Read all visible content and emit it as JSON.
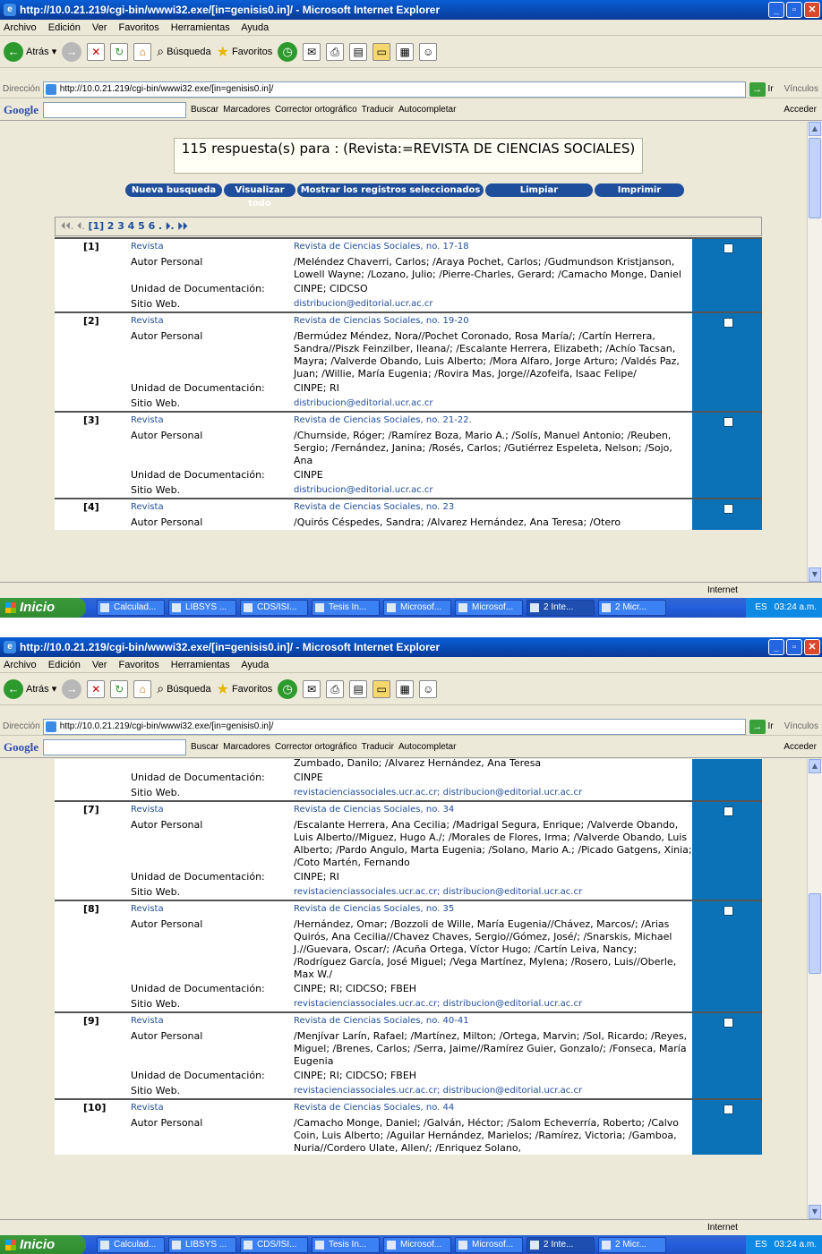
{
  "window": {
    "title": "http://10.0.21.219/cgi-bin/wwwi32.exe/[in=genisis0.in]/ - Microsoft Internet Explorer",
    "buttons": [
      "_",
      "▫",
      "✕"
    ]
  },
  "menu": [
    "Archivo",
    "Edición",
    "Ver",
    "Favoritos",
    "Herramientas",
    "Ayuda"
  ],
  "toolbar": {
    "back": "Atrás",
    "search": "Búsqueda",
    "favorites": "Favoritos"
  },
  "address": {
    "label": "Dirección",
    "url": "http://10.0.21.219/cgi-bin/wwwi32.exe/[in=genisis0.in]/",
    "go": "Ir",
    "links": "Vínculos"
  },
  "google": {
    "logo": "Google",
    "buscar": "Buscar",
    "marcadores": "Marcadores",
    "corrector": "Corrector ortográfico",
    "traducir": "Traducir",
    "autocompletar": "Autocompletar",
    "acceder": "Acceder"
  },
  "status": {
    "zone": "Internet"
  },
  "taskbar": {
    "start": "Inicio",
    "tasks": [
      "Calculad...",
      "LIBSYS ...",
      "CDS/ISI...",
      "Tesis In...",
      "Microsof...",
      "Microsof...",
      "2 Inte...",
      "2 Micr..."
    ],
    "lang": "ES",
    "time": "03:24 a.m."
  },
  "page": {
    "heading": "115 respuesta(s) para : (Revista:=REVISTA DE CIENCIAS SOCIALES)",
    "buttons": [
      "Nueva busqueda",
      "Visualizar todo",
      "Mostrar los registros seleccionados",
      "Limpiar",
      "Imprimir"
    ],
    "nav": {
      "prev": "⏴⏴. ⏴.",
      "current": "[1]",
      "pages": "2 3 4 5 6",
      "next": ". ⏵. ⏵⏵"
    }
  },
  "labels": {
    "revista": "Revista",
    "autor": "Autor Personal",
    "unidad": "Unidad de Documentación:",
    "sitio": "Sitio Web."
  },
  "records_top": [
    {
      "num": "[1]",
      "revista": "Revista de Ciencias Sociales, no. 17-18",
      "autor": "/Meléndez Chaverri, Carlos; /Araya Pochet, Carlos; /Gudmundson Kristjanson, Lowell Wayne; /Lozano, Julio; /Pierre-Charles, Gerard; /Camacho Monge, Daniel",
      "unidad": "CINPE; CIDCSO",
      "sitio": "distribucion@editorial.ucr.ac.cr"
    },
    {
      "num": "[2]",
      "revista": "Revista de Ciencias Sociales, no. 19-20",
      "autor": "/Bermúdez Méndez, Nora//Pochet Coronado, Rosa María/; /Cartín Herrera, Sandra//Piszk Feinzilber, Ileana/; /Escalante Herrera, Elizabeth; /Achío Tacsan, Mayra; /Valverde Obando, Luis Alberto; /Mora Alfaro, Jorge Arturo; /Valdés Paz, Juan; /Willie, María Eugenia; /Rovira Mas, Jorge//Azofeifa, Isaac Felipe/",
      "unidad": "CINPE; RI",
      "sitio": "distribucion@editorial.ucr.ac.cr"
    },
    {
      "num": "[3]",
      "revista": "Revista de Ciencias Sociales, no. 21-22.",
      "autor": "/Churnside, Róger; /Ramírez Boza, Mario A.; /Solís, Manuel Antonio; /Reuben, Sergio; /Fernández, Janina; /Rosés, Carlos; /Gutiérrez Espeleta, Nelson; /Sojo, Ana",
      "unidad": "CINPE",
      "sitio": "distribucion@editorial.ucr.ac.cr"
    },
    {
      "num": "[4]",
      "revista": "Revista de Ciencias Sociales, no. 23",
      "autor": "/Quirós Céspedes, Sandra; /Alvarez Hernández, Ana Teresa; /Otero"
    }
  ],
  "records_bottom": [
    {
      "num": "",
      "autor_tail": "Zumbado, Danilo; /Alvarez Hernández, Ana Teresa",
      "unidad": "CINPE",
      "sitio": "revistacienciassociales.ucr.ac.cr; distribucion@editorial.ucr.ac.cr"
    },
    {
      "num": "[7]",
      "revista": "Revista de Ciencias Sociales, no. 34",
      "autor": "/Escalante Herrera, Ana Cecilia; /Madrigal Segura, Enrique; /Valverde Obando, Luis Alberto//Miguez, Hugo A./; /Morales de Flores, Irma; /Valverde Obando, Luis Alberto; /Pardo Angulo, Marta Eugenia; /Solano, Mario A.; /Picado Gatgens, Xinia; /Coto Martén, Fernando",
      "unidad": "CINPE; RI",
      "sitio": "revistacienciassociales.ucr.ac.cr; distribucion@editorial.ucr.ac.cr"
    },
    {
      "num": "[8]",
      "revista": "Revista de Ciencias Sociales, no. 35",
      "autor": "/Hernández, Omar; /Bozzoli de Wille, María Eugenia//Chávez, Marcos/; /Arias Quirós, Ana Cecilia//Chavez Chaves, Sergio//Gómez, José/; /Snarskis, Michael J.//Guevara, Oscar/; /Acuña Ortega, Víctor Hugo; /Cartín Leiva, Nancy; /Rodríguez García, José Miguel; /Vega Martínez, Mylena; /Rosero, Luis//Oberle, Max W./",
      "unidad": "CINPE; RI; CIDCSO; FBEH",
      "sitio": "revistacienciassociales.ucr.ac.cr; distribucion@editorial.ucr.ac.cr"
    },
    {
      "num": "[9]",
      "revista": "Revista de Ciencias Sociales, no. 40-41",
      "autor": "/Menjívar Larín, Rafael; /Martínez, Milton; /Ortega, Marvin; /Sol, Ricardo; /Reyes, Miguel; /Brenes, Carlos; /Serra, Jaime//Ramírez Guier, Gonzalo/; /Fonseca, María Eugenia",
      "unidad": "CINPE; RI; CIDCSO; FBEH",
      "sitio": "revistacienciassociales.ucr.ac.cr; distribucion@editorial.ucr.ac.cr"
    },
    {
      "num": "[10]",
      "revista": "Revista de Ciencias Sociales, no. 44",
      "autor": "/Camacho Monge, Daniel; /Galván, Héctor; /Salom Echeverría, Roberto; /Calvo Coin, Luis Alberto; /Aguilar Hernández, Marielos; /Ramírez, Victoria; /Gamboa, Nuria//Cordero Ulate, Allen/; /Enriquez Solano,"
    }
  ]
}
